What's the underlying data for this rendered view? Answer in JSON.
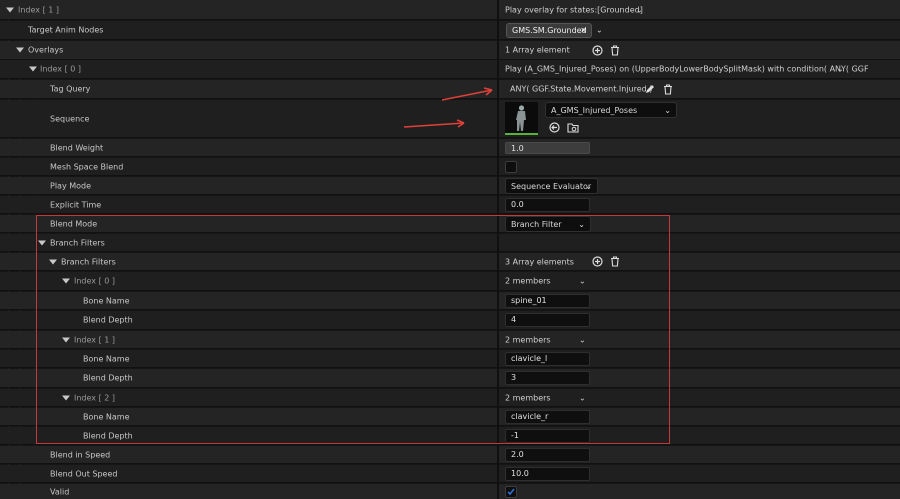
{
  "header": {
    "index_label": "Index [ 1 ]",
    "summary": "Play overlay for states:[Grounded]"
  },
  "target_anim_nodes": {
    "label": "Target Anim Nodes",
    "chip": "GMS.SM.Grounded"
  },
  "overlays": {
    "label": "Overlays",
    "count": "1 Array element"
  },
  "overlay_index0": {
    "label": "Index [ 0 ]",
    "summary": "Play (A_GMS_Injured_Poses) on (UpperBodyLowerBodySplitMask) with condition( ANY( GGF"
  },
  "tag_query": {
    "label": "Tag Query",
    "value": "ANY( GGF.State.Movement.Injured )"
  },
  "sequence": {
    "label": "Sequence",
    "asset": "A_GMS_Injured_Poses"
  },
  "blend_weight": {
    "label": "Blend Weight",
    "value": "1.0",
    "fill": 1.0
  },
  "mesh_space_blend": {
    "label": "Mesh Space Blend",
    "checked": false
  },
  "play_mode": {
    "label": "Play Mode",
    "value": "Sequence Evaluator"
  },
  "explicit_time": {
    "label": "Explicit Time",
    "value": "0.0"
  },
  "blend_mode": {
    "label": "Blend Mode",
    "value": "Branch Filter"
  },
  "branch_filters_group": {
    "label": "Branch Filters"
  },
  "branch_filters": {
    "label": "Branch Filters",
    "count": "3 Array elements"
  },
  "filters": [
    {
      "index": "Index [ 0 ]",
      "members": "2 members",
      "bone_label": "Bone Name",
      "bone": "spine_01",
      "depth_label": "Blend Depth",
      "depth": "4"
    },
    {
      "index": "Index [ 1 ]",
      "members": "2 members",
      "bone_label": "Bone Name",
      "bone": "clavicle_l",
      "depth_label": "Blend Depth",
      "depth": "3"
    },
    {
      "index": "Index [ 2 ]",
      "members": "2 members",
      "bone_label": "Bone Name",
      "bone": "clavicle_r",
      "depth_label": "Blend Depth",
      "depth": "-1"
    }
  ],
  "blend_in_speed": {
    "label": "Blend in Speed",
    "value": "2.0"
  },
  "blend_out_speed": {
    "label": "Blend Out Speed",
    "value": "10.0"
  },
  "valid": {
    "label": "Valid",
    "checked": true
  },
  "colors": {
    "highlight_box": "#c23a3a",
    "annotation_arrow": "#e0403a",
    "checkbox_accent": "#2f6fd6"
  }
}
